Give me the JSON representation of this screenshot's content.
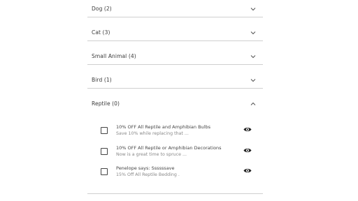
{
  "categories": [
    {
      "label": "Dog (2)"
    },
    {
      "label": "Cat (3)"
    },
    {
      "label": "Small Animal (4)"
    },
    {
      "label": "Bird (1)"
    }
  ],
  "open_category": {
    "label": "Reptile (0)",
    "items": [
      {
        "title": "10% OFF All Reptile and Amphibian Bulbs",
        "subtitle": "Save 10% while replacing that ..."
      },
      {
        "title": "10% OFF All Reptile or Amphibian Decorations",
        "subtitle": "Now is a great time to spruce ..."
      },
      {
        "title": "Penelope says: Ssssssave",
        "subtitle": "15% Off All Reptile Bedding ."
      }
    ]
  },
  "icons": {
    "collapsed_chevron": "chevron-down-icon",
    "expanded_chevron": "chevron-up-icon",
    "view": "eye-icon"
  }
}
